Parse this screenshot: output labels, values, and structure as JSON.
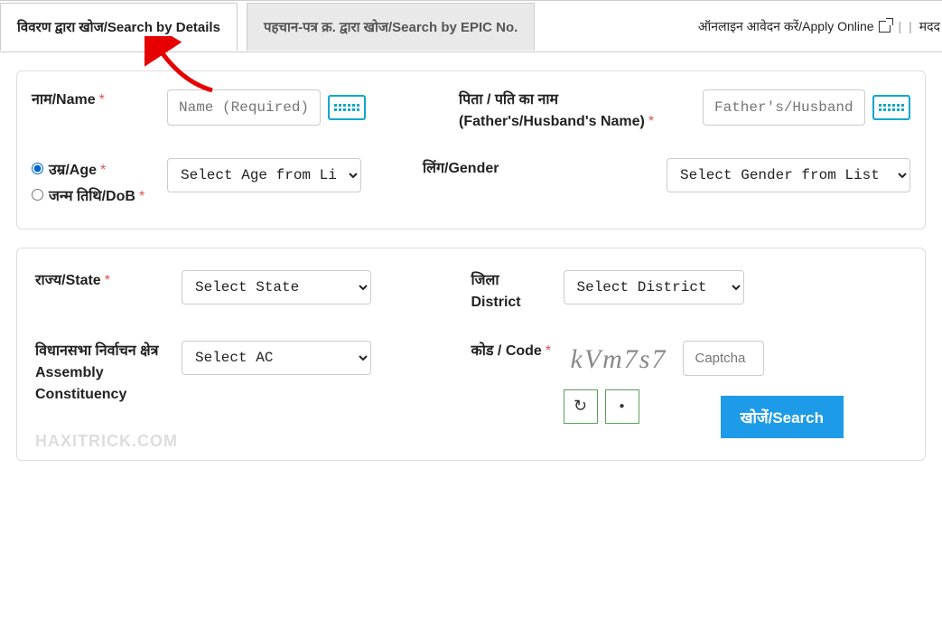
{
  "tabs": {
    "details": "विवरण द्वारा खोज/Search by Details",
    "epic": "पहचान-पत्र क्र. द्वारा खोज/Search by EPIC No."
  },
  "topLinks": {
    "apply": "ऑनलाइन आवेदन करें/Apply Online",
    "help": "मदद"
  },
  "form": {
    "name": {
      "label": "नाम/Name",
      "placeholder": "Name (Required)"
    },
    "father": {
      "label": "पिता / पति का नाम (Father's/Husband's Name)",
      "placeholder": "Father's/Husband's na"
    },
    "ageRadio": "उम्र/Age",
    "dobRadio": "जन्म तिथि/DoB",
    "ageSelect": "Select Age from Li",
    "gender": {
      "label": "लिंग/Gender",
      "select": "Select Gender from List"
    },
    "state": {
      "label": "राज्य/State",
      "select": "Select State"
    },
    "district": {
      "label": "जिला District",
      "select": "Select District"
    },
    "ac": {
      "label": "विधानसभा निर्वाचन क्षेत्र Assembly Constituency",
      "select": "Select AC"
    },
    "code": {
      "label": "कोड / Code",
      "captcha": "kVm7s7",
      "placeholder": "Captcha"
    },
    "search": "खोजें/Search"
  },
  "watermark": "HAXITRICK.COM"
}
